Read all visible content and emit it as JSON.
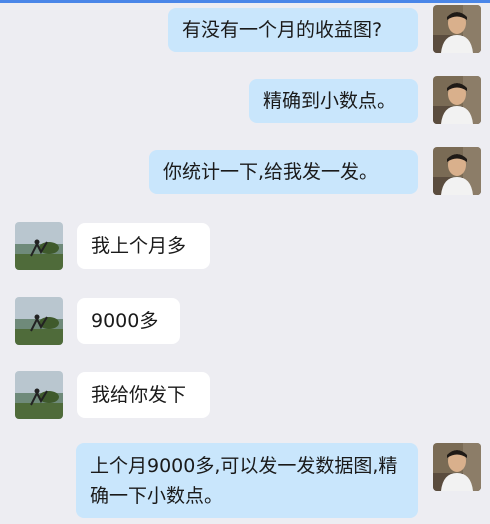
{
  "messages": [
    {
      "side": "out",
      "text": "有没有一个月的收益图?"
    },
    {
      "side": "out",
      "text": "精确到小数点。"
    },
    {
      "side": "out",
      "text": "你统计一下,给我发一发。"
    },
    {
      "side": "in",
      "text": "我上个月多"
    },
    {
      "side": "in",
      "text": "9000多"
    },
    {
      "side": "in",
      "text": "我给你发下"
    },
    {
      "side": "out",
      "text": "上个月9000多,可以发一发数据图,精确一下小数点。"
    }
  ]
}
